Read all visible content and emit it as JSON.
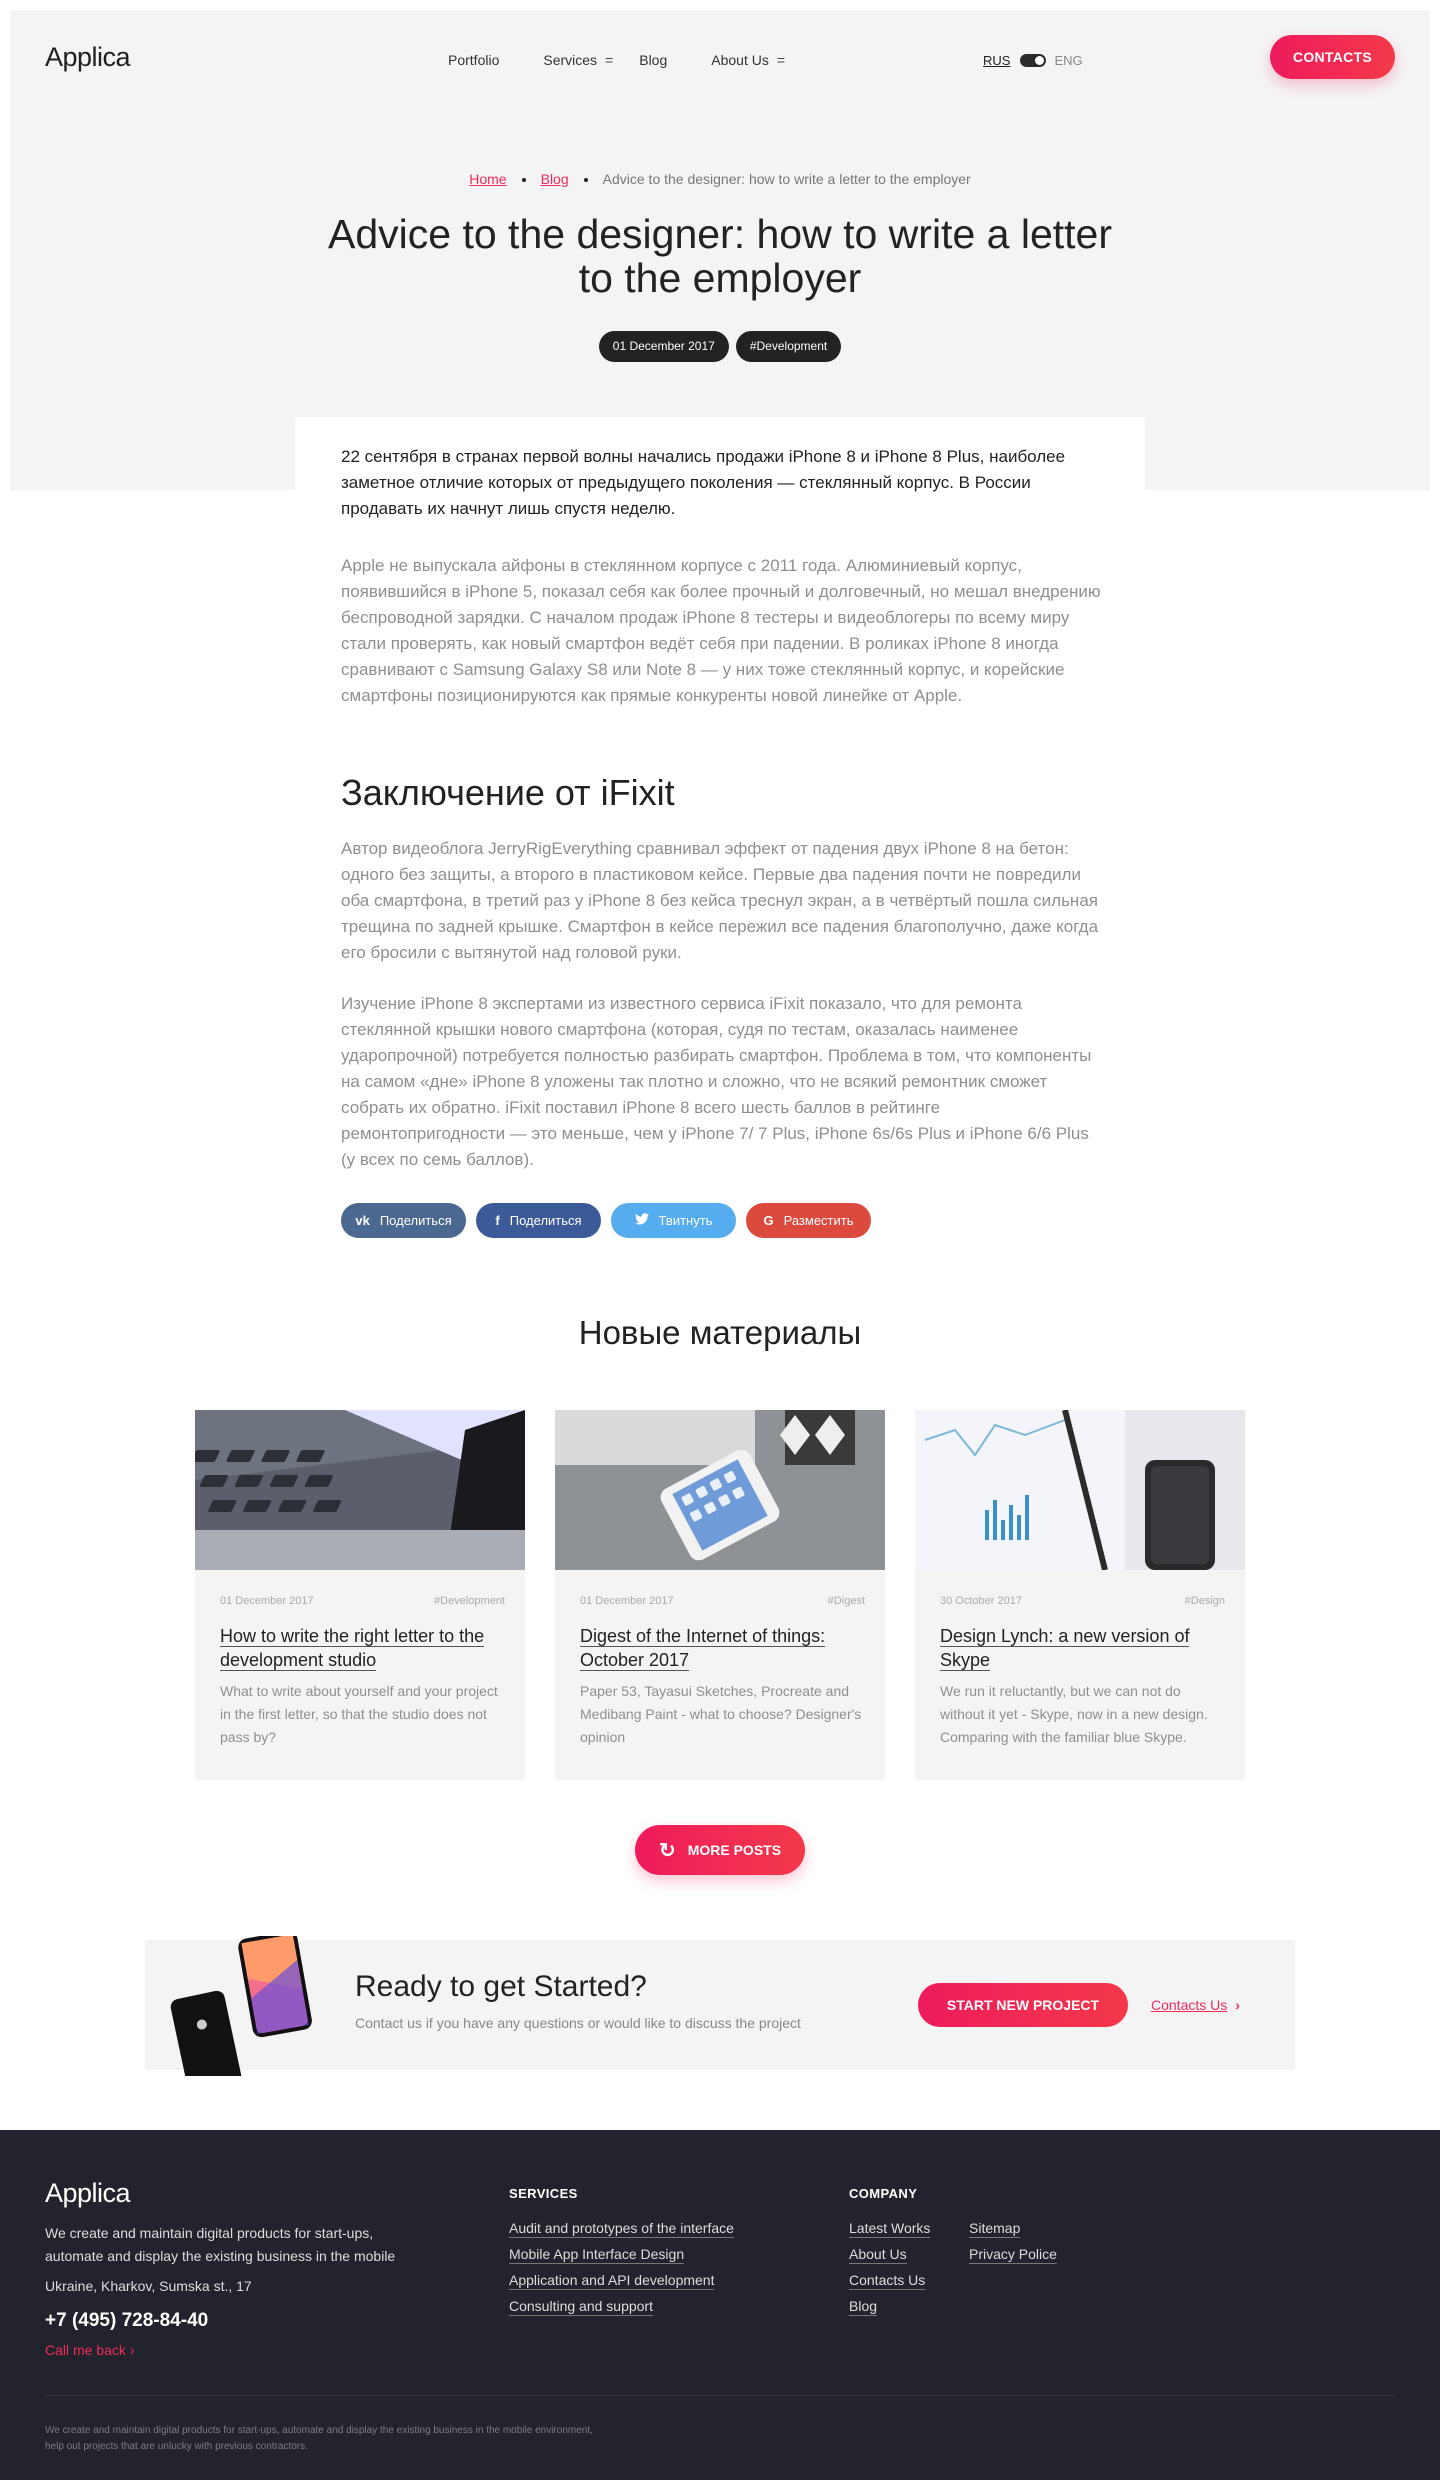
{
  "header": {
    "logo": "Applica",
    "nav": [
      {
        "label": "Portfolio",
        "has_menu": false
      },
      {
        "label": "Services",
        "has_menu": true
      },
      {
        "label": "Blog",
        "has_menu": false
      },
      {
        "label": "About Us",
        "has_menu": true
      }
    ],
    "menu_indicator": "=",
    "lang_rus": "RUS",
    "lang_eng": "ENG",
    "contacts_button": "CONTACTS"
  },
  "breadcrumb": {
    "home": "Home",
    "blog": "Blog",
    "current": "Advice to the designer: how to write a letter to the employer"
  },
  "post": {
    "title": "Advice to the designer: how to write a letter to the employer",
    "date": "01 December 2017",
    "tag": "#Development",
    "lead": "22 сентября в странах первой волны начались продажи iPhone 8 и iPhone 8 Plus, наиболее заметное отличие которых от предыдущего поколения — стеклянный корпус. В России продавать их начнут лишь спустя неделю.",
    "paragraph1": "Apple не выпускала айфоны в стеклянном корпусе с 2011 года. Алюминиевый корпус, появившийся в iPhone 5, показал себя как более прочный и долговечный, но мешал внедрению беспроводной зарядки. С началом продаж iPhone 8 тестеры и видеоблогеры по всему миру стали проверять, как новый смартфон ведёт себя при падении. В роликах iPhone 8 иногда сравнивают с Samsung Galaxy S8 или Note 8 — у них тоже стеклянный корпус, и корейские смартфоны позиционируются как прямые конкуренты новой линейке от Apple.",
    "subheading": "Заключение от iFixit",
    "paragraph2": "Автор видеоблога JerryRigEverything сравнивал эффект от падения двух iPhone 8 на бетон: одного без защиты, а второго в пластиковом кейсе. Первые два падения почти не повредили оба смартфона, в третий раз у iPhone 8 без кейса треснул экран, а в четвёртый пошла сильная трещина по задней крышке. Смартфон в кейсе пережил все падения благополучно, даже когда его бросили с вытянутой над головой руки.",
    "paragraph3": "Изучение iPhone 8 экспертами из известного сервиса iFixit показало, что для ремонта стеклянной крышки нового смартфона (которая, судя по тестам, оказалась наименее ударопрочной) потребуется полностью разбирать смартфон. Проблема в том, что компоненты на самом «дне» iPhone 8 уложены так плотно и сложно, что не всякий ремонтник сможет собрать их обратно. iFixit поставил iPhone 8 всего шесть баллов в рейтинге ремонтопригодности — это меньше, чем у iPhone 7/ 7 Plus, iPhone 6s/6s Plus и iPhone 6/6 Plus (у всех по семь баллов)."
  },
  "share": [
    {
      "label": "Поделиться",
      "icon": "vk-icon",
      "glyph": "vk",
      "color": "#4a6890"
    },
    {
      "label": "Поделиться",
      "icon": "facebook-icon",
      "glyph": "f",
      "color": "#3d5a98"
    },
    {
      "label": "Твитнуть",
      "icon": "twitter-icon",
      "glyph": "t",
      "color": "#55acee"
    },
    {
      "label": "Разместить",
      "icon": "google-plus-icon",
      "glyph": "G",
      "color": "#dc4a3d"
    }
  ],
  "new_materials": {
    "title": "Новые материалы",
    "cards": [
      {
        "date": "01 December 2017",
        "tag": "#Development",
        "title": "How to write the right letter to the development studio",
        "desc": "What to write about yourself and your project in the first letter, so that the studio does not pass by?"
      },
      {
        "date": "01 December 2017",
        "tag": "#Digest",
        "title": "Digest of the Internet of things: October 2017",
        "desc": "Paper 53, Tayasui Sketches, Procreate and Medibang Paint - what to choose? Designer's opinion"
      },
      {
        "date": "30 October 2017",
        "tag": "#Design",
        "title": "Design Lynch: a new version of Skype",
        "desc": "We run it reluctantly, but we can not do without it yet - Skype, now in a new design. Comparing with the familiar blue Skype."
      }
    ],
    "more_button": "MORE POSTS"
  },
  "cta": {
    "title": "Ready to get Started?",
    "subtitle": "Contact us if you have any questions or would like to discuss the project",
    "button": "START NEW PROJECT",
    "link": "Contacts Us"
  },
  "footer": {
    "logo": "Applica",
    "description": "We create and maintain digital products for start-ups, automate and display the existing business in the mobile",
    "address": "Ukraine, Kharkov, Sumska st., 17",
    "phone": "+7 (495) 728-84-40",
    "call_back": "Call me back",
    "services_title": "SERVICES",
    "services": [
      "Audit and prototypes of the interface",
      "Mobile App Interface Design",
      "Application and API development",
      "Consulting and support"
    ],
    "company_title": "COMPANY",
    "company_col1": [
      "Latest Works",
      "About Us",
      "Contacts Us",
      "Blog"
    ],
    "company_col2": [
      "Sitemap",
      "Privacy Police"
    ],
    "small_text": "We create and maintain digital products for start-ups, automate and display the existing business in the mobile environment, help out projects that are unlucky with previous contractors."
  },
  "colors": {
    "accent": "#ee1b5c",
    "dark": "#23232d",
    "light_bg": "#f4f4f4",
    "muted_text": "#8f8f8f"
  }
}
